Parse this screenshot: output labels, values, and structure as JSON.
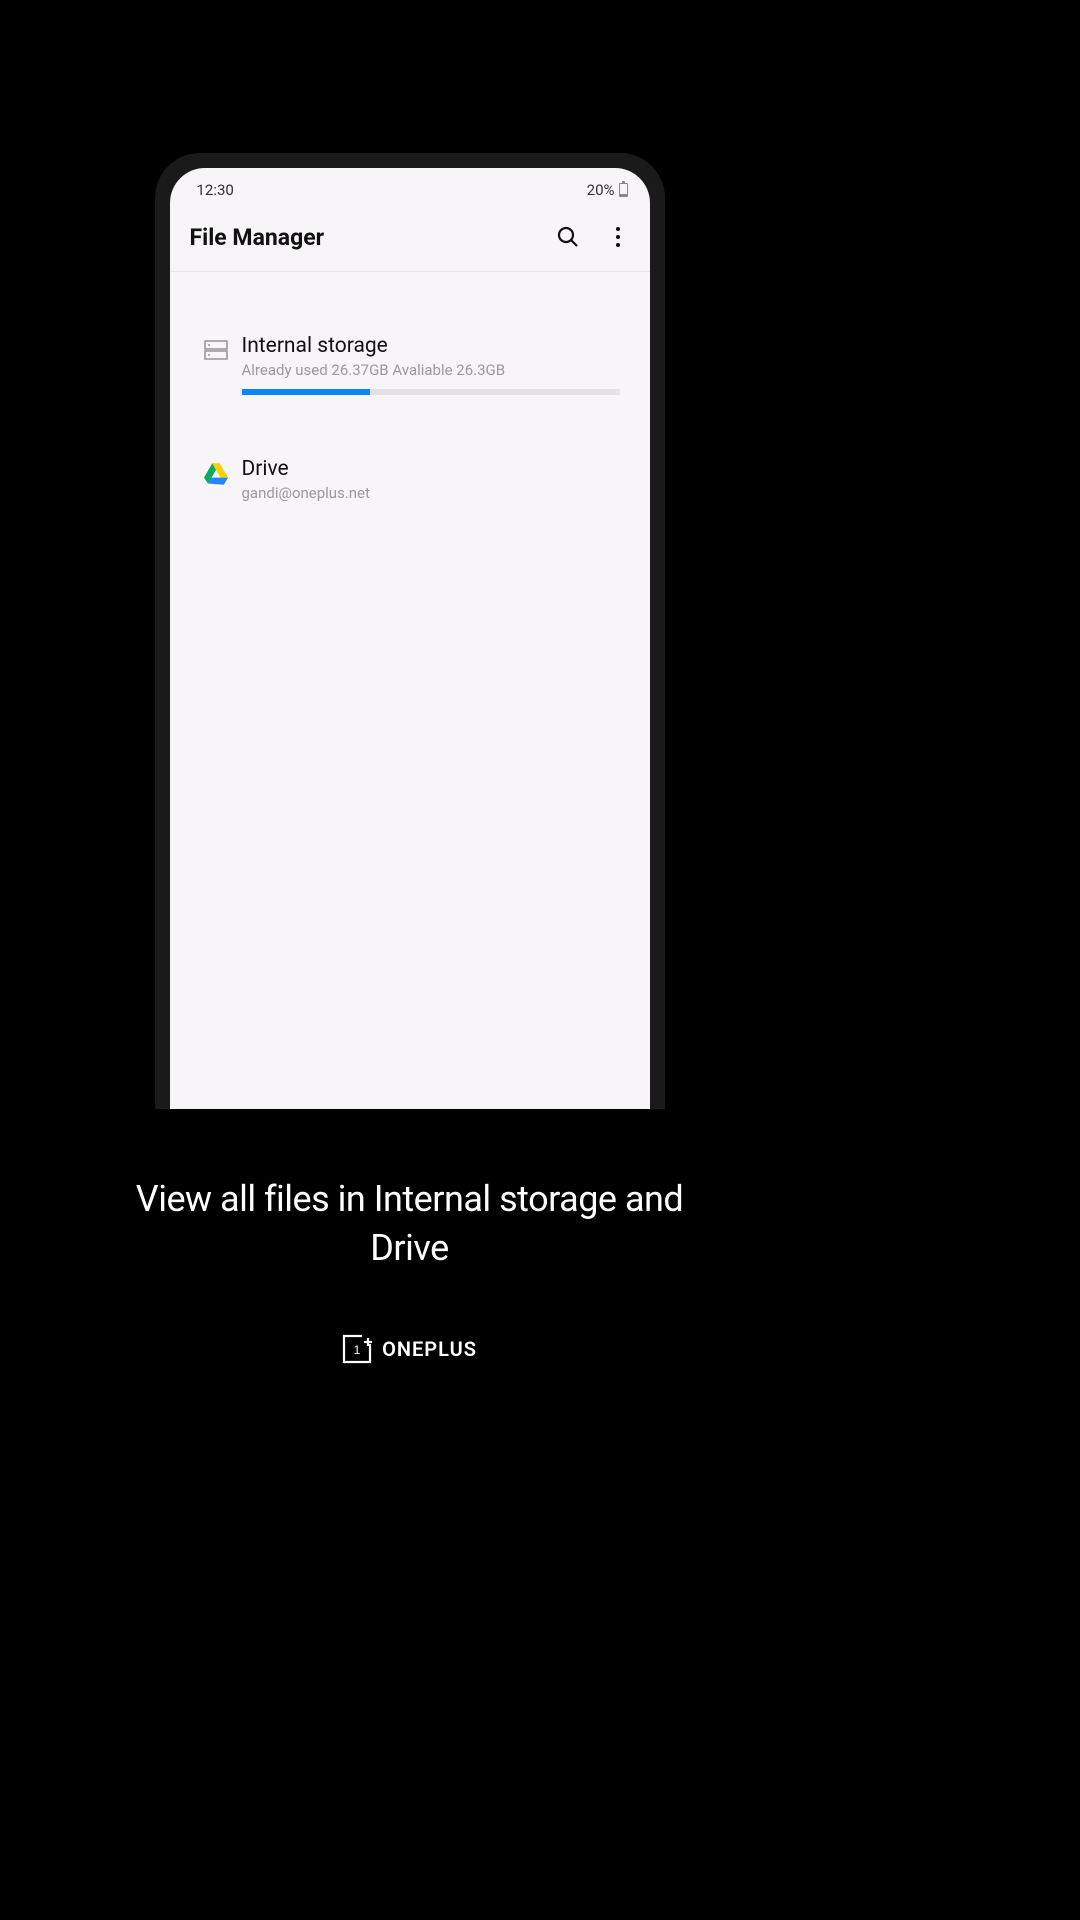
{
  "status": {
    "time": "12:30",
    "battery_text": "20%"
  },
  "header": {
    "title": "File Manager"
  },
  "storage": {
    "internal": {
      "title": "Internal storage",
      "subtitle": "Already used 26.37GB Avaliable 26.3GB",
      "progress_percent": 34
    },
    "drive": {
      "title": "Drive",
      "subtitle": "gandi@oneplus.net"
    }
  },
  "caption": "View all files in Internal storage and Drive",
  "brand": "ONEPLUS"
}
